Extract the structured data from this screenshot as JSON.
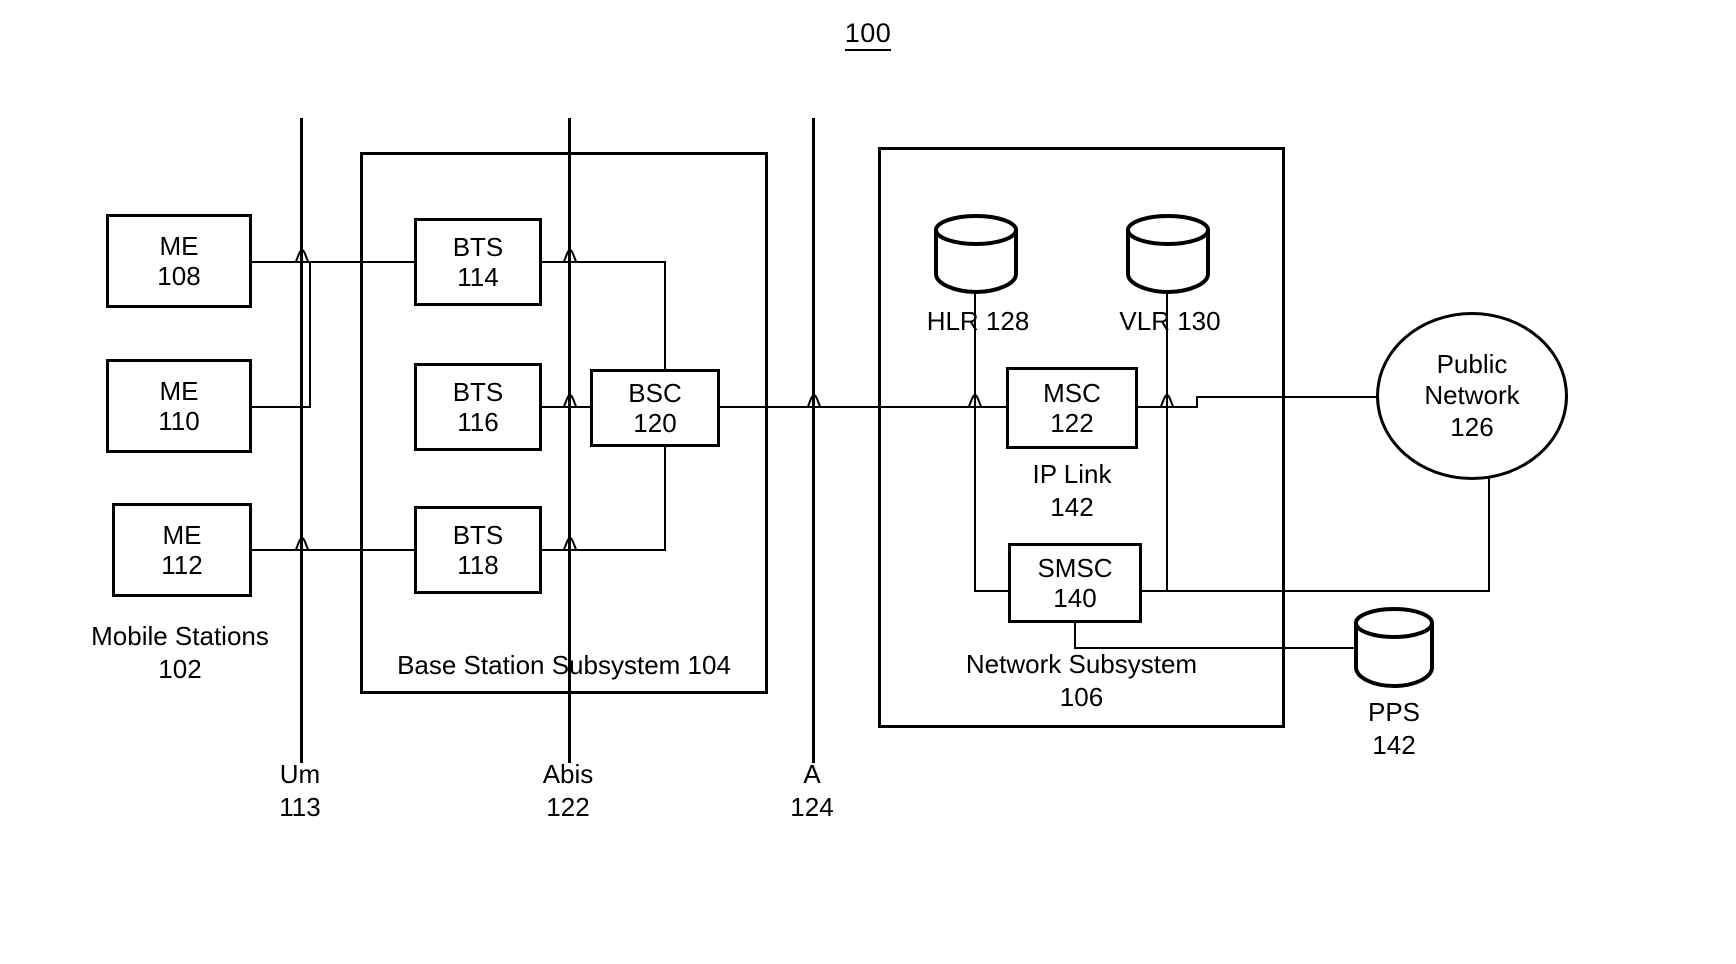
{
  "figure": {
    "number": "100"
  },
  "mobile_stations": {
    "group_label_line1": "Mobile Stations",
    "group_label_line2": "102",
    "nodes": [
      {
        "name": "ME",
        "ref": "108"
      },
      {
        "name": "ME",
        "ref": "110"
      },
      {
        "name": "ME",
        "ref": "112"
      }
    ]
  },
  "base_station_subsystem": {
    "group_label": "Base Station Subsystem 104",
    "bts": [
      {
        "name": "BTS",
        "ref": "114"
      },
      {
        "name": "BTS",
        "ref": "116"
      },
      {
        "name": "BTS",
        "ref": "118"
      }
    ],
    "bsc": {
      "name": "BSC",
      "ref": "120"
    }
  },
  "network_subsystem": {
    "group_label_line1": "Network Subsystem",
    "group_label_line2": "106",
    "hlr": {
      "label": "HLR 128"
    },
    "vlr": {
      "label": "VLR 130"
    },
    "msc": {
      "name": "MSC",
      "ref": "122"
    },
    "smsc": {
      "name": "SMSC",
      "ref": "140"
    },
    "ip_link": {
      "line1": "IP Link",
      "line2": "142"
    }
  },
  "external": {
    "public_network": {
      "line1": "Public",
      "line2": "Network",
      "line3": "126"
    },
    "pps": {
      "line1": "PPS",
      "line2": "142"
    }
  },
  "interfaces": [
    {
      "name": "Um",
      "ref": "113"
    },
    {
      "name": "Abis",
      "ref": "122"
    },
    {
      "name": "A",
      "ref": "124"
    }
  ],
  "colors": {
    "stroke": "#000000",
    "background": "#ffffff"
  }
}
